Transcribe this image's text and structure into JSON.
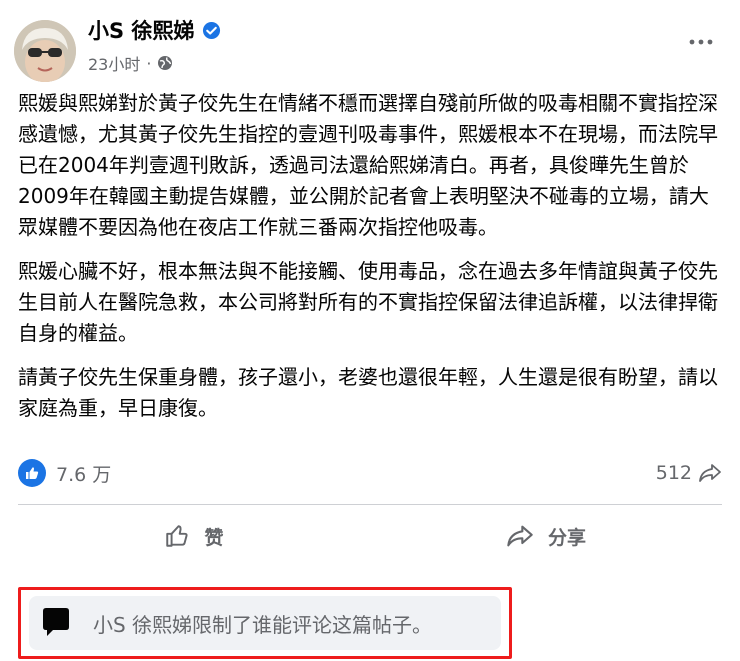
{
  "post": {
    "author": "小S 徐熙娣",
    "time": "23小时",
    "separator": "·",
    "paragraphs": [
      "熙媛與熙娣對於黃子佼先生在情緒不穩而選擇自殘前所做的吸毒相關不實指控深感遺憾，尤其黃子佼先生指控的壹週刊吸毒事件，熙媛根本不在現場，而法院早已在2004年判壹週刊敗訴，透過司法還給熙娣清白。再者，具俊曄先生曾於2009年在韓國主動提告媒體，並公開於記者會上表明堅決不碰毒的立場，請大眾媒體不要因為他在夜店工作就三番兩次指控他吸毒。",
      "熙媛心臟不好，根本無法與不能接觸、使用毒品，念在過去多年情誼與黃子佼先生目前人在醫院急救，本公司將對所有的不實指控保留法律追訴權，以法律捍衛自身的權益。",
      "請黃子佼先生保重身體，孩子還小，老婆也還很年輕，人生還是很有盼望，請以家庭為重，早日康復。"
    ]
  },
  "stats": {
    "reactions_count": "7.6 万",
    "shares_count": "512"
  },
  "actions": {
    "like_label": "赞",
    "share_label": "分享"
  },
  "restriction": {
    "text": "小S 徐熙娣限制了谁能评论这篇帖子。"
  },
  "colors": {
    "brand_blue": "#1b74e4",
    "secondary_text": "#65676b",
    "highlight_border": "#ee1c1c"
  },
  "icons": {
    "verified": "verified-badge-icon",
    "privacy": "globe-icon",
    "more": "more-horizontal-icon",
    "like_reaction": "thumbs-up-icon",
    "share_count": "share-arrow-icon",
    "like_action": "thumbs-up-outline-icon",
    "share_action": "share-arrow-icon",
    "comment_restricted": "speech-bubble-icon"
  }
}
